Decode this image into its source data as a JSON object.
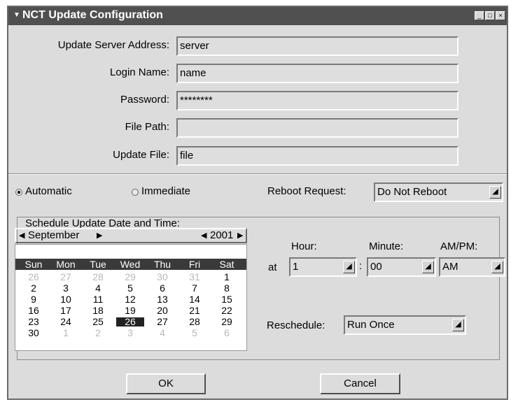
{
  "window": {
    "title": "NCT Update Configuration"
  },
  "fields": {
    "server_label": "Update Server Address:",
    "server_value": "server",
    "login_label": "Login Name:",
    "login_value": "name",
    "password_label": "Password:",
    "password_value": "********",
    "filepath_label": "File Path:",
    "filepath_value": "",
    "updatefile_label": "Update File:",
    "updatefile_value": "file"
  },
  "mode": {
    "automatic_label": "Automatic",
    "immediate_label": "Immediate",
    "selected": "Automatic",
    "reboot_label": "Reboot Request:",
    "reboot_value": "Do Not Reboot"
  },
  "schedule": {
    "group_label": "Schedule Update Date and Time:",
    "month": "September",
    "year": "2001",
    "day_names": [
      "Sun",
      "Mon",
      "Tue",
      "Wed",
      "Thu",
      "Fri",
      "Sat"
    ],
    "weeks": [
      [
        "26",
        "27",
        "28",
        "29",
        "30",
        "31",
        "1"
      ],
      [
        "2",
        "3",
        "4",
        "5",
        "6",
        "7",
        "8"
      ],
      [
        "9",
        "10",
        "11",
        "12",
        "13",
        "14",
        "15"
      ],
      [
        "16",
        "17",
        "18",
        "19",
        "20",
        "21",
        "22"
      ],
      [
        "23",
        "24",
        "25",
        "26",
        "27",
        "28",
        "29"
      ],
      [
        "30",
        "1",
        "2",
        "3",
        "4",
        "5",
        "6"
      ]
    ],
    "selected_day": "26",
    "at_label": "at",
    "hour_label": "Hour:",
    "hour_value": "1",
    "minute_label": "Minute:",
    "minute_value": "00",
    "ampm_label": "AM/PM:",
    "ampm_value": "AM",
    "colon": ":",
    "reschedule_label": "Reschedule:",
    "reschedule_value": "Run Once"
  },
  "buttons": {
    "ok": "OK",
    "cancel": "Cancel"
  }
}
